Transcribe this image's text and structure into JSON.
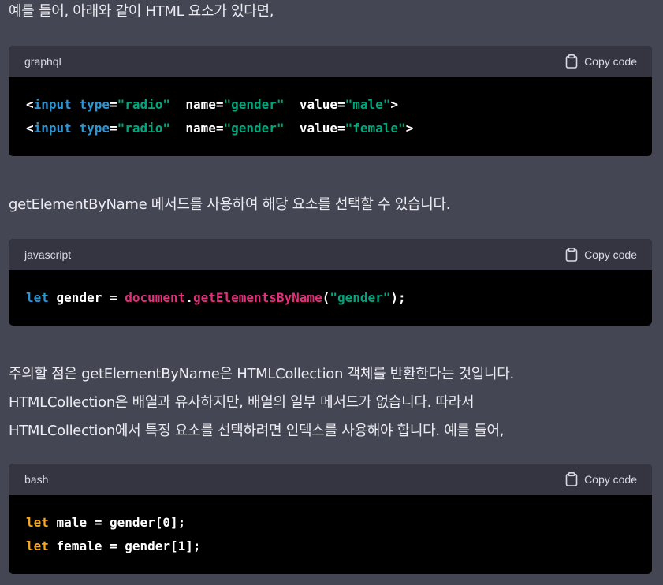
{
  "intro": {
    "line1": "예를 들어, 아래와 같이 HTML 요소가 있다면,"
  },
  "copy_label": "Copy code",
  "block1": {
    "language": "graphql",
    "lines": [
      [
        {
          "t": "<",
          "c": "plain"
        },
        {
          "t": "input",
          "c": "tag"
        },
        {
          "t": " ",
          "c": "plain"
        },
        {
          "t": "type",
          "c": "attr"
        },
        {
          "t": "=",
          "c": "plain"
        },
        {
          "t": "\"radio\"",
          "c": "str"
        },
        {
          "t": "  name=",
          "c": "plain"
        },
        {
          "t": "\"gender\"",
          "c": "str"
        },
        {
          "t": "  value=",
          "c": "plain"
        },
        {
          "t": "\"male\"",
          "c": "str"
        },
        {
          "t": ">",
          "c": "plain"
        }
      ],
      [
        {
          "t": "<",
          "c": "plain"
        },
        {
          "t": "input",
          "c": "tag"
        },
        {
          "t": " ",
          "c": "plain"
        },
        {
          "t": "type",
          "c": "attr"
        },
        {
          "t": "=",
          "c": "plain"
        },
        {
          "t": "\"radio\"",
          "c": "str"
        },
        {
          "t": "  name=",
          "c": "plain"
        },
        {
          "t": "\"gender\"",
          "c": "str"
        },
        {
          "t": "  value=",
          "c": "plain"
        },
        {
          "t": "\"female\"",
          "c": "str"
        },
        {
          "t": ">",
          "c": "plain"
        }
      ]
    ]
  },
  "para2": {
    "line1": "getElementByName 메서드를 사용하여 해당 요소를 선택할 수 있습니다."
  },
  "block2": {
    "language": "javascript",
    "lines": [
      [
        {
          "t": "let",
          "c": "kw-blue"
        },
        {
          "t": " gender = ",
          "c": "plain"
        },
        {
          "t": "document",
          "c": "fn"
        },
        {
          "t": ".",
          "c": "plain"
        },
        {
          "t": "getElementsByName",
          "c": "fn"
        },
        {
          "t": "(",
          "c": "plain"
        },
        {
          "t": "\"gender\"",
          "c": "str"
        },
        {
          "t": ");",
          "c": "plain"
        }
      ]
    ]
  },
  "para3": {
    "line1": "주의할 점은 getElementByName은 HTMLCollection 객체를 반환한다는 것입니다.",
    "line2": "HTMLCollection은 배열과 유사하지만, 배열의 일부 메서드가 없습니다. 따라서",
    "line3": "HTMLCollection에서 특정 요소를 선택하려면 인덱스를 사용해야 합니다. 예를 들어,"
  },
  "block3": {
    "language": "bash",
    "lines": [
      [
        {
          "t": "let",
          "c": "kw-orange"
        },
        {
          "t": " male = gender[0];",
          "c": "plain"
        }
      ],
      [
        {
          "t": "let",
          "c": "kw-orange"
        },
        {
          "t": " female = gender[1];",
          "c": "plain"
        }
      ]
    ]
  },
  "colors": {
    "background": "#444654",
    "code_header": "#343541",
    "code_body": "#000000",
    "tag": "#2e95d3",
    "string": "#00a67d",
    "function": "#df3079",
    "keyword_orange": "#f5a623"
  }
}
